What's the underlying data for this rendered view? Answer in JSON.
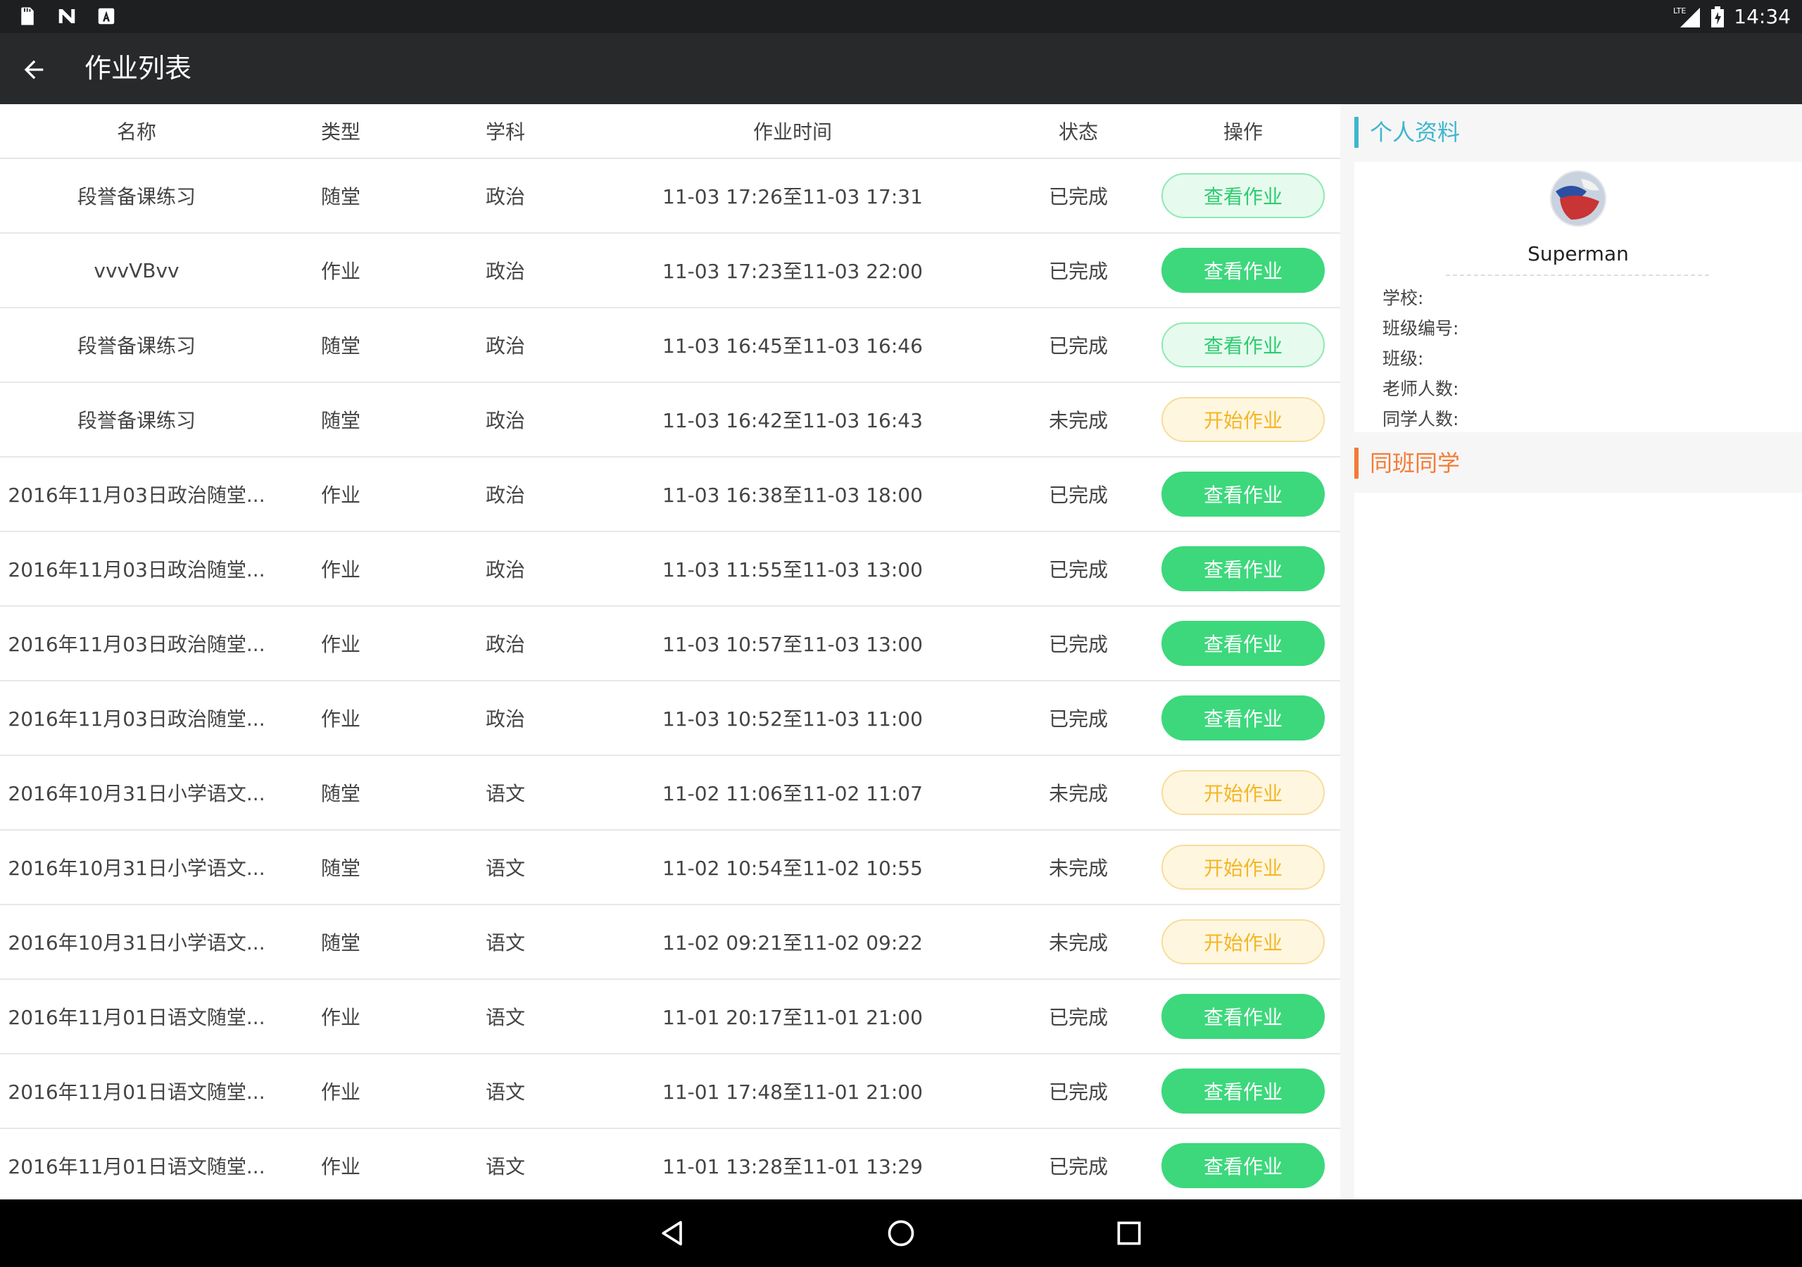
{
  "status_bar": {
    "time": "14:34",
    "left_icons": [
      "sd-card-icon",
      "n-logo-icon",
      "a-letter-icon"
    ],
    "right_icons": [
      "lte-signal-icon",
      "battery-icon"
    ],
    "lte_label": "LTE"
  },
  "appbar": {
    "title": "作业列表",
    "back_icon": "arrow-left-icon"
  },
  "table": {
    "headers": {
      "name": "名称",
      "type": "类型",
      "subject": "学科",
      "time": "作业时间",
      "status": "状态",
      "op": "操作"
    },
    "rows": [
      {
        "name": "段誉备课练习",
        "type": "随堂",
        "subject": "政治",
        "time": "11-03 17:26至11-03 17:31",
        "status": "已完成",
        "action": "查看作业",
        "action_style": "light"
      },
      {
        "name": "vvvVBvv",
        "type": "作业",
        "subject": "政治",
        "time": "11-03 17:23至11-03 22:00",
        "status": "已完成",
        "action": "查看作业",
        "action_style": "solid"
      },
      {
        "name": "段誉备课练习",
        "type": "随堂",
        "subject": "政治",
        "time": "11-03 16:45至11-03 16:46",
        "status": "已完成",
        "action": "查看作业",
        "action_style": "light"
      },
      {
        "name": "段誉备课练习",
        "type": "随堂",
        "subject": "政治",
        "time": "11-03 16:42至11-03 16:43",
        "status": "未完成",
        "action": "开始作业",
        "action_style": "start"
      },
      {
        "name": "2016年11月03日政治随堂...",
        "type": "作业",
        "subject": "政治",
        "time": "11-03 16:38至11-03 18:00",
        "status": "已完成",
        "action": "查看作业",
        "action_style": "solid"
      },
      {
        "name": "2016年11月03日政治随堂...",
        "type": "作业",
        "subject": "政治",
        "time": "11-03 11:55至11-03 13:00",
        "status": "已完成",
        "action": "查看作业",
        "action_style": "solid"
      },
      {
        "name": "2016年11月03日政治随堂...",
        "type": "作业",
        "subject": "政治",
        "time": "11-03 10:57至11-03 13:00",
        "status": "已完成",
        "action": "查看作业",
        "action_style": "solid"
      },
      {
        "name": "2016年11月03日政治随堂...",
        "type": "作业",
        "subject": "政治",
        "time": "11-03 10:52至11-03 11:00",
        "status": "已完成",
        "action": "查看作业",
        "action_style": "solid"
      },
      {
        "name": "2016年10月31日小学语文...",
        "type": "随堂",
        "subject": "语文",
        "time": "11-02 11:06至11-02 11:07",
        "status": "未完成",
        "action": "开始作业",
        "action_style": "start"
      },
      {
        "name": "2016年10月31日小学语文...",
        "type": "随堂",
        "subject": "语文",
        "time": "11-02 10:54至11-02 10:55",
        "status": "未完成",
        "action": "开始作业",
        "action_style": "start"
      },
      {
        "name": "2016年10月31日小学语文...",
        "type": "随堂",
        "subject": "语文",
        "time": "11-02 09:21至11-02 09:22",
        "status": "未完成",
        "action": "开始作业",
        "action_style": "start"
      },
      {
        "name": "2016年11月01日语文随堂...",
        "type": "作业",
        "subject": "语文",
        "time": "11-01 20:17至11-01 21:00",
        "status": "已完成",
        "action": "查看作业",
        "action_style": "solid"
      },
      {
        "name": "2016年11月01日语文随堂...",
        "type": "作业",
        "subject": "语文",
        "time": "11-01 17:48至11-01 21:00",
        "status": "已完成",
        "action": "查看作业",
        "action_style": "solid"
      },
      {
        "name": "2016年11月01日语文随堂...",
        "type": "作业",
        "subject": "语文",
        "time": "11-01 13:28至11-01 13:29",
        "status": "已完成",
        "action": "查看作业",
        "action_style": "solid"
      }
    ]
  },
  "side": {
    "profile_heading": "个人资料",
    "username": "Superman",
    "info_labels": [
      "学校:",
      "班级编号:",
      "班级:",
      "老师人数:",
      "同学人数:"
    ],
    "classmates_heading": "同班同学"
  },
  "colors": {
    "accent_green": "#3dd87c",
    "accent_yellow": "#f4b624",
    "profile_blue": "#3fb6cf",
    "classmates_orange": "#f47b35"
  },
  "navbar": {
    "icons": [
      "back-triangle-icon",
      "home-circle-icon",
      "recents-square-icon"
    ]
  }
}
